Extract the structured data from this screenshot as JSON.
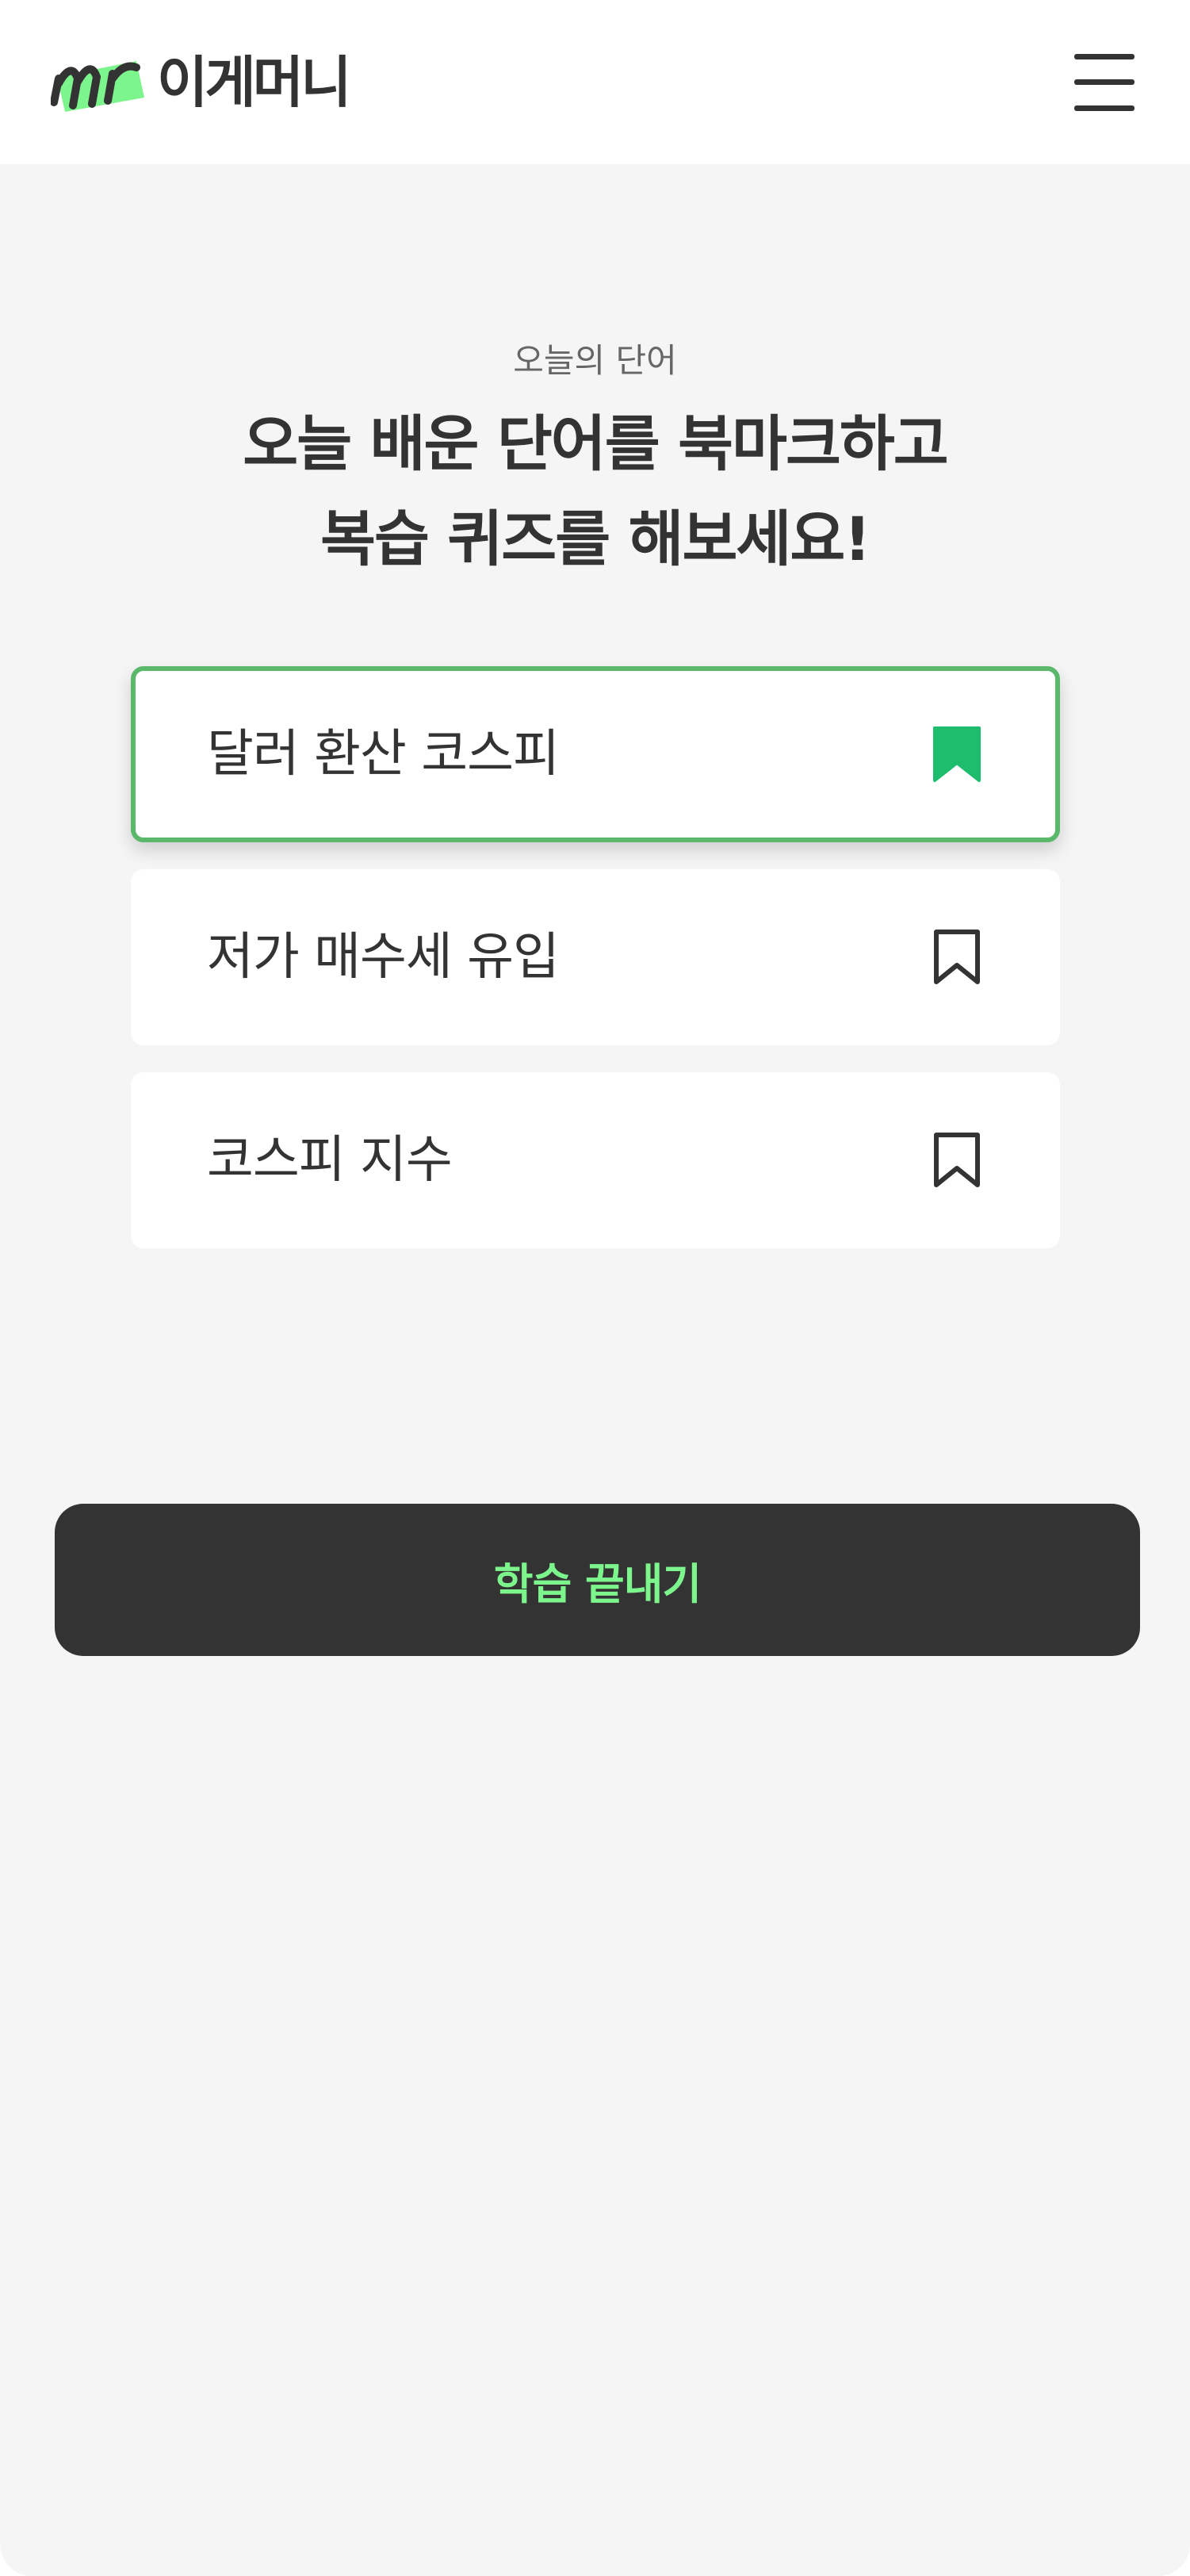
{
  "header": {
    "logo_text": "이게머니",
    "logo_mark_icon": "m-brush-logo-icon",
    "menu_icon": "hamburger-menu-icon"
  },
  "intro": {
    "subtitle": "오늘의 단어",
    "headline_line1": "오늘 배운 단어를 북마크하고",
    "headline_line2": "복습 퀴즈를 해보세요!"
  },
  "words": [
    {
      "label": "달러 환산 코스피",
      "bookmarked": true,
      "selected": true
    },
    {
      "label": "저가 매수세 유입",
      "bookmarked": false,
      "selected": false
    },
    {
      "label": "코스피 지수",
      "bookmarked": false,
      "selected": false
    }
  ],
  "finish_button": {
    "label": "학습 끝내기"
  },
  "colors": {
    "accent_green": "#1ebd6e",
    "selected_border": "#5ab86a",
    "button_text": "#7cf58c",
    "dark": "#333333",
    "background": "#f5f5f5"
  }
}
